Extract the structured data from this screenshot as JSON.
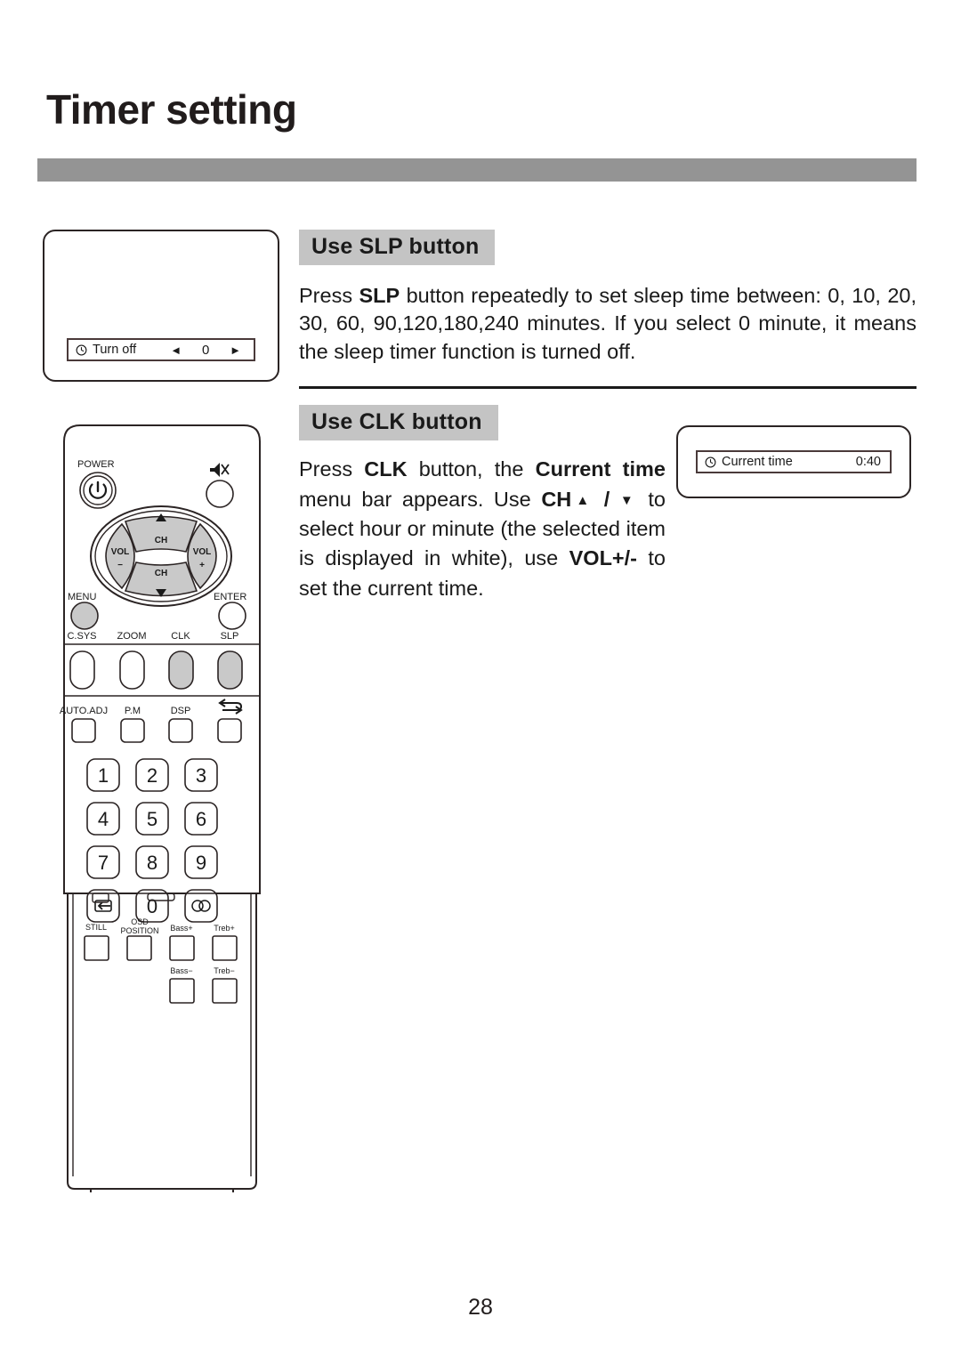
{
  "page": {
    "title": "Timer setting",
    "number": "28"
  },
  "sections": {
    "slp": {
      "heading": "Use SLP button",
      "paragraph_prefix": "Press ",
      "paragraph_bold": "SLP",
      "paragraph_rest": " button repeatedly to set sleep time between: 0, 10, 20, 30, 60, 90,120,180,240 minutes. If you select 0 minute, it means the sleep timer function is turned off."
    },
    "clk": {
      "heading": "Use CLK button",
      "t1": "Press ",
      "b1": "CLK",
      "t2": " button, the ",
      "b2": "Current time",
      "t3": " menu bar appears. Use ",
      "b3": "CH",
      "arrow_up": "▲",
      "slash": " / ",
      "arrow_down": "▼",
      "t4": " to select hour or minute (the selected item is displayed in white), use ",
      "b4": "VOL+/-",
      "t5": " to set the current  time."
    }
  },
  "osd": {
    "turn_off": {
      "icon": "clock-icon",
      "label": "Turn off",
      "arrow_left": "◄",
      "value": "0",
      "arrow_right": "►"
    },
    "current_time": {
      "icon": "clock-icon",
      "label": "Current time",
      "value": "0:40"
    }
  },
  "remote": {
    "power_label": "POWER",
    "mute_icon": "mute-icon",
    "power_icon": "power-icon",
    "dpad": {
      "ch_up": "CH",
      "ch_up_arrow": "▲",
      "ch_down": "CH",
      "ch_down_arrow": "▼",
      "vol_minus_top": "VOL",
      "vol_minus_bottom": "−",
      "vol_plus_top": "VOL",
      "vol_plus_bottom": "+"
    },
    "menu_label": "MENU",
    "enter_label": "ENTER",
    "row_fn1": [
      "C.SYS",
      "ZOOM",
      "CLK",
      "SLP"
    ],
    "row_fn2": [
      "AUTO.ADJ",
      "P.M",
      "DSP"
    ],
    "row_fn2_icon": "swap-icon",
    "keypad": [
      "1",
      "2",
      "3",
      "4",
      "5",
      "6",
      "7",
      "8",
      "9"
    ],
    "keypad_return_icon": "return-icon",
    "keypad_zero": "0",
    "keypad_stereo_icon": "stereo-icon",
    "bottom_labels": {
      "still": "STILL",
      "osd": "OSD",
      "position": "POSITION",
      "bass_plus": "Bass+",
      "treb_plus": "Treb+",
      "bass_minus": "Bass−",
      "treb_minus": "Treb−"
    }
  },
  "colors": {
    "title_bar": "#949494",
    "section_head_bg": "#c4c4c4",
    "button_gray": "#c9c9c9",
    "ink": "#1a1a1a"
  }
}
